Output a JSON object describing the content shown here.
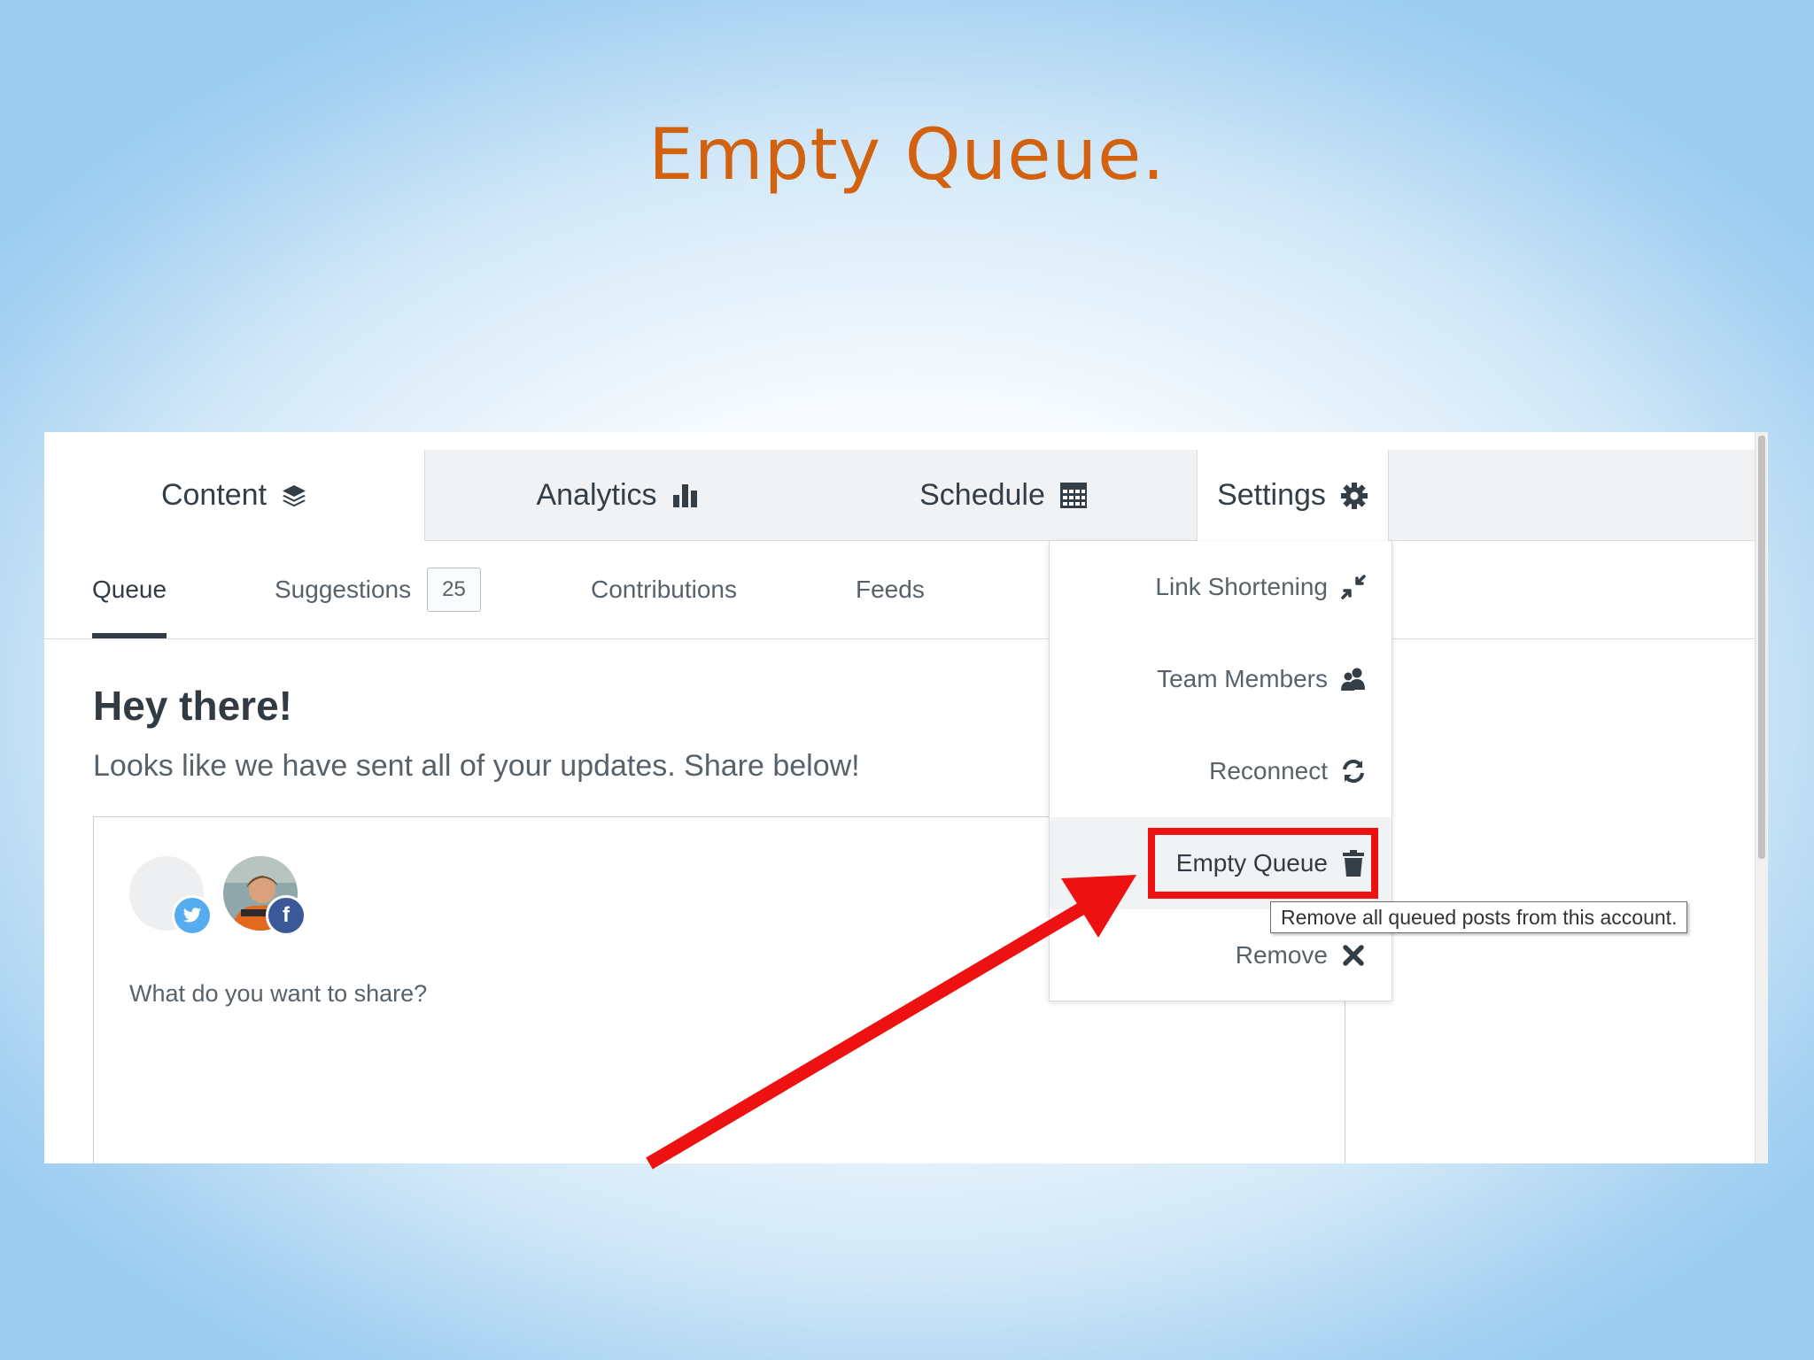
{
  "slide": {
    "title": "Empty Queue."
  },
  "main_tabs": [
    {
      "label": "Content",
      "icon": "layers-icon"
    },
    {
      "label": "Analytics",
      "icon": "bar-chart-icon"
    },
    {
      "label": "Schedule",
      "icon": "calendar-icon"
    },
    {
      "label": "Settings",
      "icon": "gear-icon"
    }
  ],
  "sub_tabs": [
    {
      "label": "Queue",
      "active": true
    },
    {
      "label": "Suggestions",
      "badge": "25"
    },
    {
      "label": "Contributions"
    },
    {
      "label": "Feeds"
    }
  ],
  "main": {
    "greeting": "Hey there!",
    "message": "Looks like we have sent all of your updates. Share below!",
    "composer_prompt": "What do you want to share?"
  },
  "settings_menu": [
    {
      "label": "Link Shortening",
      "icon": "compress-icon"
    },
    {
      "label": "Team Members",
      "icon": "team-icon"
    },
    {
      "label": "Reconnect",
      "icon": "refresh-icon"
    },
    {
      "label": "Empty Queue",
      "icon": "trash-icon",
      "highlighted": true
    },
    {
      "label": "Remove",
      "icon": "close-icon"
    }
  ],
  "tooltip": "Remove all queued posts from this account.",
  "colors": {
    "title": "#d2620f",
    "highlight": "#ee1111",
    "twitter": "#55acee",
    "facebook": "#3b5998"
  }
}
